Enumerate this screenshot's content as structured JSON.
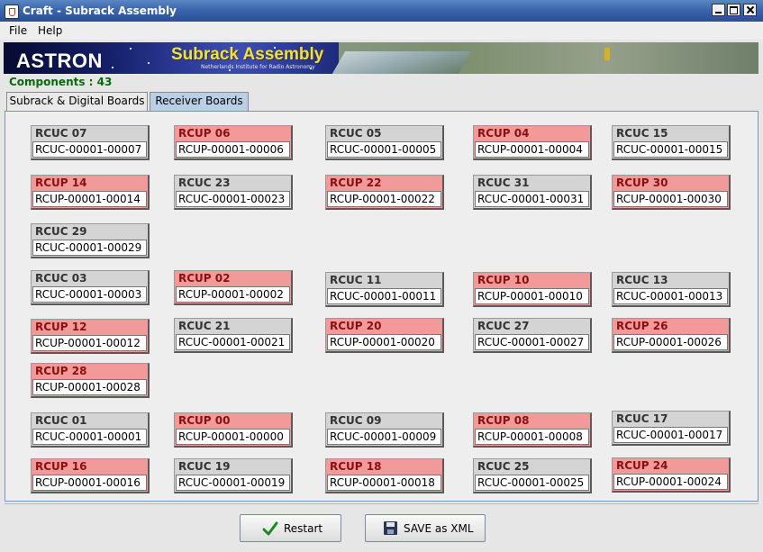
{
  "window": {
    "title": "Craft - Subrack Assembly"
  },
  "menu": {
    "file": "File",
    "help": "Help"
  },
  "banner": {
    "logo": "ASTRON",
    "title": "Subrack Assembly",
    "subtitle": "Netherlands Institute for Radio Astronomy"
  },
  "components_label": "Components : 43",
  "tabs": [
    {
      "label": "Subrack & Digital Boards"
    },
    {
      "label": "Receiver Boards"
    }
  ],
  "colors": {
    "rcuc_card": "#d4d4d4",
    "rcup_card": "#f29a9a",
    "components_text": "#0a6a0a"
  },
  "boards": [
    {
      "label": "RCUC 07",
      "value": "RCUC-00001-00007"
    },
    {
      "label": "RCUP 06",
      "value": "RCUP-00001-00006"
    },
    {
      "label": "RCUC 05",
      "value": "RCUC-00001-00005"
    },
    {
      "label": "RCUP 04",
      "value": "RCUP-00001-00004"
    },
    {
      "label": "RCUC 15",
      "value": "RCUC-00001-00015"
    },
    {
      "label": "RCUP 14",
      "value": "RCUP-00001-00014"
    },
    {
      "label": "RCUC 23",
      "value": "RCUC-00001-00023"
    },
    {
      "label": "RCUP 22",
      "value": "RCUP-00001-00022"
    },
    {
      "label": "RCUC 31",
      "value": "RCUC-00001-00031"
    },
    {
      "label": "RCUP 30",
      "value": "RCUP-00001-00030"
    },
    {
      "label": "RCUC 29",
      "value": "RCUC-00001-00029"
    },
    {
      "label": "RCUC 03",
      "value": "RCUC-00001-00003"
    },
    {
      "label": "RCUP 02",
      "value": "RCUP-00001-00002"
    },
    {
      "label": "RCUC 11",
      "value": "RCUC-00001-00011"
    },
    {
      "label": "RCUP 10",
      "value": "RCUP-00001-00010"
    },
    {
      "label": "RCUC 13",
      "value": "RCUC-00001-00013"
    },
    {
      "label": "RCUP 12",
      "value": "RCUP-00001-00012"
    },
    {
      "label": "RCUC 21",
      "value": "RCUC-00001-00021"
    },
    {
      "label": "RCUP 20",
      "value": "RCUP-00001-00020"
    },
    {
      "label": "RCUC 27",
      "value": "RCUC-00001-00027"
    },
    {
      "label": "RCUP 26",
      "value": "RCUP-00001-00026"
    },
    {
      "label": "RCUP 28",
      "value": "RCUP-00001-00028"
    },
    {
      "label": "RCUC 01",
      "value": "RCUC-00001-00001"
    },
    {
      "label": "RCUP 00",
      "value": "RCUP-00001-00000"
    },
    {
      "label": "RCUC 09",
      "value": "RCUC-00001-00009"
    },
    {
      "label": "RCUP 08",
      "value": "RCUP-00001-00008"
    },
    {
      "label": "RCUC 17",
      "value": "RCUC-00001-00017"
    },
    {
      "label": "RCUP 16",
      "value": "RCUP-00001-00016"
    },
    {
      "label": "RCUC 19",
      "value": "RCUC-00001-00019"
    },
    {
      "label": "RCUP 18",
      "value": "RCUP-00001-00018"
    },
    {
      "label": "RCUC 25",
      "value": "RCUC-00001-00025"
    },
    {
      "label": "RCUP 24",
      "value": "RCUP-00001-00024"
    }
  ],
  "buttons": {
    "restart": "Restart",
    "save": "SAVE as XML"
  }
}
